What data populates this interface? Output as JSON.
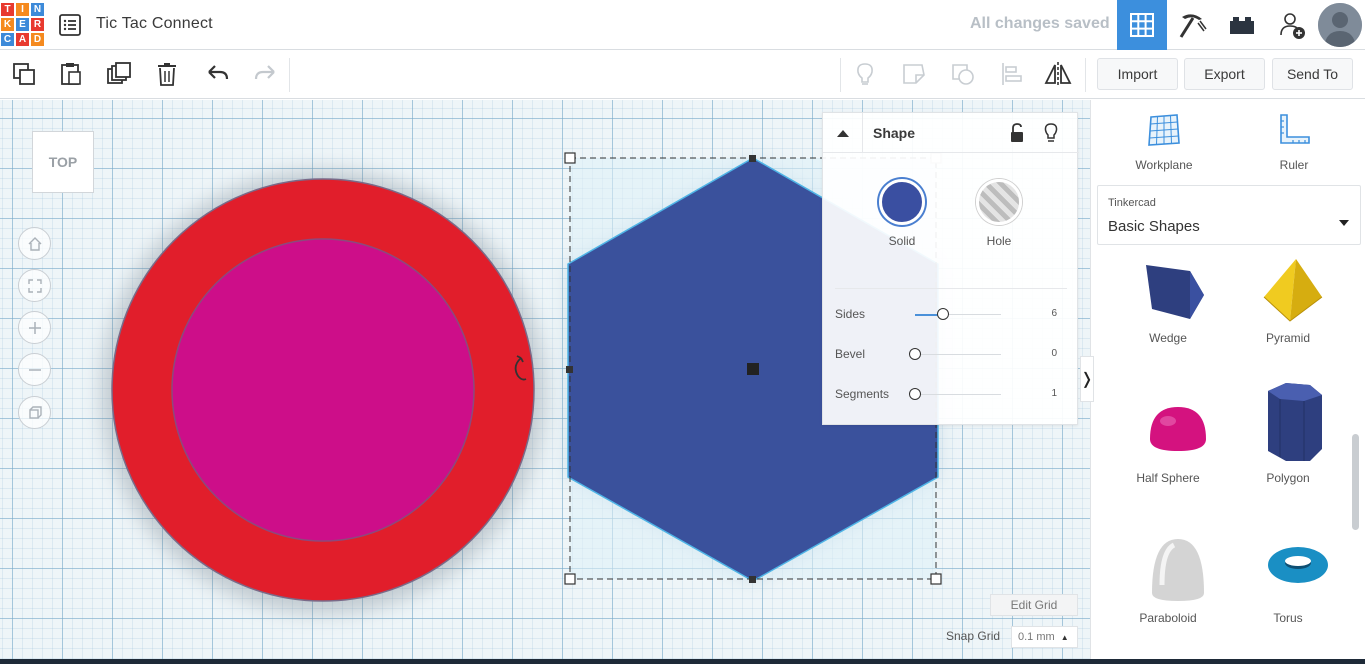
{
  "app": {
    "logo_letters": [
      "T",
      "I",
      "N",
      "K",
      "E",
      "R",
      "C",
      "A",
      "D"
    ],
    "logo_colors": [
      "#e83a2f",
      "#f58a1f",
      "#3d8ad9",
      "#f58a1f",
      "#3d8ad9",
      "#e83a2f",
      "#3d8ad9",
      "#e83a2f",
      "#f58a1f"
    ],
    "design_title": "Tic Tac Connect",
    "save_status": "All changes saved",
    "accent_color": "#3c8fdd"
  },
  "header_icons": [
    "menu-list-icon",
    "grid-3d-view-icon",
    "pickaxe-icon",
    "bricks-icon",
    "add-user-icon",
    "avatar"
  ],
  "toolbar": {
    "import_label": "Import",
    "export_label": "Export",
    "sendto_label": "Send To"
  },
  "workplane": {
    "view_cube_label": "TOP",
    "shapes": [
      {
        "name": "ring-outer",
        "color": "#e11e2b"
      },
      {
        "name": "ring-inner",
        "color": "#cd0e89"
      },
      {
        "name": "hexagon",
        "color": "#3a519c"
      }
    ],
    "edit_grid_label": "Edit Grid",
    "snap_grid_label": "Snap Grid",
    "snap_grid_value": "0.1 mm"
  },
  "inspector": {
    "title": "Shape",
    "solid_label": "Solid",
    "hole_label": "Hole",
    "solid_color": "#3a4fa1",
    "props": [
      {
        "label": "Sides",
        "value": "6",
        "fraction": 0.33
      },
      {
        "label": "Bevel",
        "value": "0",
        "fraction": 0.0
      },
      {
        "label": "Segments",
        "value": "1",
        "fraction": 0.0
      }
    ]
  },
  "right_panel": {
    "workplane_label": "Workplane",
    "ruler_label": "Ruler",
    "library_small": "Tinkercad",
    "library_name": "Basic Shapes",
    "shapes": [
      {
        "label": "Wedge",
        "color": "#2e3f7f"
      },
      {
        "label": "Pyramid",
        "color": "#e8c21a"
      },
      {
        "label": "Half Sphere",
        "color": "#d4127f"
      },
      {
        "label": "Polygon",
        "color": "#2e3f7f"
      },
      {
        "label": "Paraboloid",
        "color": "#d9d9d9"
      },
      {
        "label": "Torus",
        "color": "#1a8fc4"
      }
    ]
  }
}
